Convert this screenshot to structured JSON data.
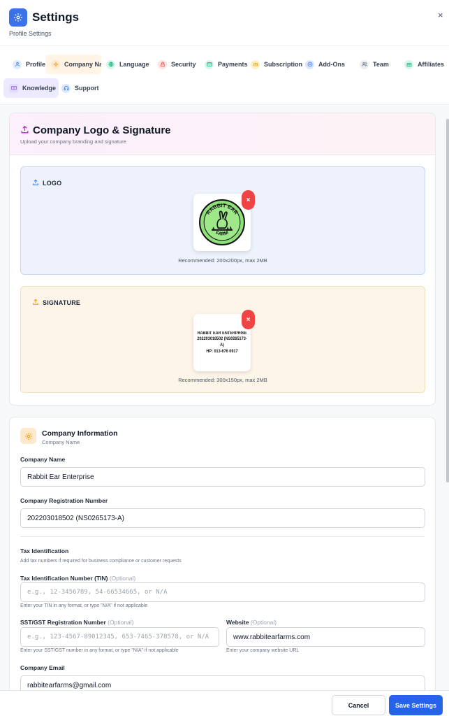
{
  "header": {
    "title": "Settings",
    "subtitle": "Profile Settings",
    "close_label": "×"
  },
  "tabs": [
    {
      "label": "Profile",
      "icon": "user-icon",
      "color": "#3b82f6"
    },
    {
      "label": "Company Name",
      "icon": "gear-icon",
      "color": "#f59e0b",
      "active": true
    },
    {
      "label": "Language",
      "icon": "globe-icon",
      "color": "#10b981"
    },
    {
      "label": "Security",
      "icon": "lock-icon",
      "color": "#ef4444"
    },
    {
      "label": "Payments",
      "icon": "credit-card-icon",
      "color": "#10b981"
    },
    {
      "label": "Subscription",
      "icon": "crown-icon",
      "color": "#f59e0b"
    },
    {
      "label": "Add-Ons",
      "icon": "addon-icon",
      "color": "#3b82f6"
    },
    {
      "label": "Team",
      "icon": "users-icon",
      "color": "#6b7280"
    },
    {
      "label": "Affiliates",
      "icon": "gift-icon",
      "color": "#10b981"
    },
    {
      "label": "Knowledge",
      "icon": "book-icon",
      "color": "#8b5cf6"
    },
    {
      "label": "Support",
      "icon": "headset-icon",
      "color": "#3b82f6"
    }
  ],
  "branding": {
    "title": "Company Logo & Signature",
    "subtitle": "Upload your company branding and signature",
    "logo": {
      "label": "LOGO",
      "recommended": "Recommended: 200x200px, max 2MB",
      "text_top": "RABBIT EAR",
      "text_bottom": "FARM"
    },
    "signature": {
      "label": "SIGNATURE",
      "recommended": "Recommended: 300x150px, max 2MB",
      "lines": [
        "RABBIT EAR ENTERPRISE",
        "202203018502 (NS0265173-A)",
        "HP: 013-676 0917"
      ]
    },
    "remove_label": "×"
  },
  "company_info": {
    "title": "Company Information",
    "subtitle": "Company Name",
    "name_label": "Company Name",
    "name_value": "Rabbit Ear Enterprise",
    "reg_label": "Company Registration Number",
    "reg_value": "202203018502 (NS0265173-A)",
    "tax_title": "Tax Identification",
    "tax_sub": "Add tax numbers if required for business compliance or customer requests",
    "tin_label": "Tax Identification Number (TIN)",
    "optional": "(Optional)",
    "tin_placeholder": "e.g., 12-3456789, 54-66534665, or N/A",
    "tin_hint": "Enter your TIN in any format, or type \"N/A\" if not applicable",
    "sst_label": "SST/GST Registration Number",
    "sst_placeholder": "e.g., 123-4567-89012345, 653-7465-378578, or N/A",
    "sst_hint": "Enter your SST/GST number in any format, or type \"N/A\" if not applicable",
    "website_label": "Website",
    "website_value": "www.rabbitearfarms.com",
    "website_hint": "Enter your company website URL",
    "email_label": "Company Email",
    "email_value": "rabbitearfarms@gmail.com"
  },
  "footer": {
    "cancel_label": "Cancel",
    "save_label": "Save Settings"
  },
  "colors": {
    "primary": "#2563eb",
    "danger": "#ef4444"
  }
}
